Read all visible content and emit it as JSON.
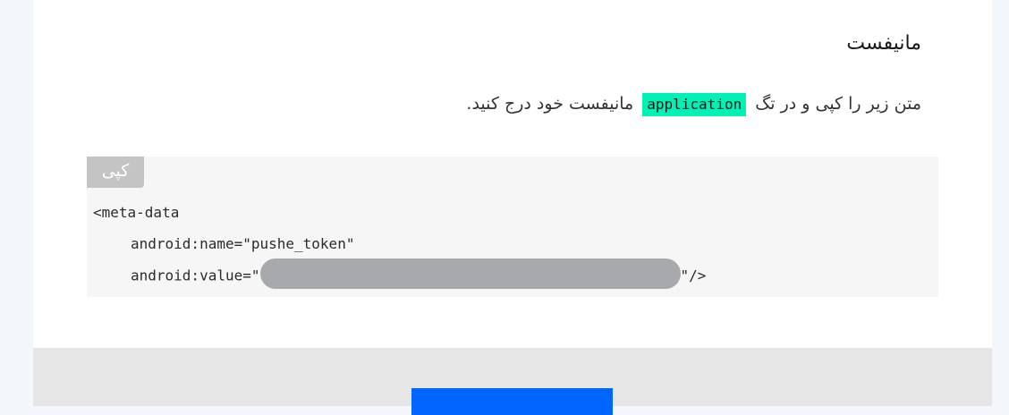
{
  "section": {
    "title": "مانیفست",
    "instruction_before": "متن زیر را کپی و در تگ",
    "tag_name": "application",
    "instruction_after": "مانیفست خود درج کنید."
  },
  "code_block": {
    "copy_label": "کپی",
    "line1": "<meta-data",
    "line2": "android:name=\"pushe_token\"",
    "line3_prefix": "android:value=\"",
    "line3_suffix": "\"/>"
  },
  "colors": {
    "tag_highlight": "#00f0b5",
    "primary_button": "#0066ff",
    "redaction": "#a8a9ac"
  }
}
